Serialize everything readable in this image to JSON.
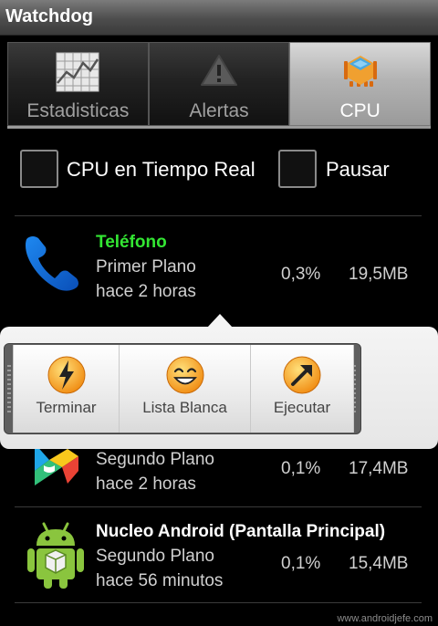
{
  "app": {
    "title": "Watchdog"
  },
  "tabs": [
    {
      "label": "Estadisticas",
      "icon": "statistics-chart-icon",
      "active": false
    },
    {
      "label": "Alertas",
      "icon": "warning-triangle-icon",
      "active": false
    },
    {
      "label": "CPU",
      "icon": "cpu-chip-icon",
      "active": true
    }
  ],
  "options": {
    "realtime_label": "CPU en Tiempo Real",
    "realtime_checked": false,
    "pause_label": "Pausar",
    "pause_checked": false
  },
  "processes": [
    {
      "name": "Teléfono",
      "state": "Primer Plano",
      "time": "hace 2 horas",
      "cpu": "0,3%",
      "mem": "19,5MB",
      "icon": "phone-icon",
      "name_color": "#33e633"
    },
    {
      "name": "",
      "state": "Segundo Plano",
      "time": "hace 2 horas",
      "cpu": "0,1%",
      "mem": "17,4MB",
      "icon": "play-store-icon"
    },
    {
      "name": "Nucleo Android (Pantalla Principal)",
      "state": "Segundo Plano",
      "time": "hace 56 minutos",
      "cpu": "0,1%",
      "mem": "15,4MB",
      "icon": "android-robot-icon",
      "name_color": "#ffffff"
    }
  ],
  "quick_actions": [
    {
      "label": "Terminar",
      "icon": "lightning-icon"
    },
    {
      "label": "Lista Blanca",
      "icon": "smiley-icon"
    },
    {
      "label": "Ejecutar",
      "icon": "arrow-up-right-icon"
    }
  ],
  "watermark": "www.androidjefe.com",
  "colors": {
    "accent_green": "#33e633",
    "icon_orange": "#f5a623"
  }
}
